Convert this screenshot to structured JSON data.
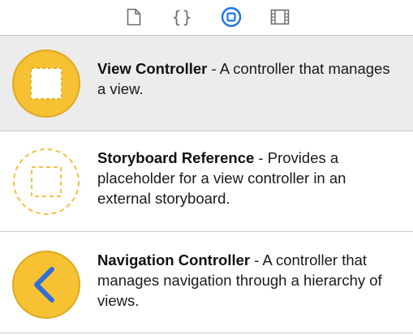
{
  "tabs": [
    {
      "icon": "file-icon"
    },
    {
      "icon": "braces-icon",
      "label": "{}"
    },
    {
      "icon": "object-library-icon"
    },
    {
      "icon": "media-library-icon"
    }
  ],
  "items": [
    {
      "title": "View Controller",
      "separator": " - ",
      "description": "A controller that manages a view.",
      "icon": "view-controller-icon"
    },
    {
      "title": "Storyboard Reference",
      "separator": " - ",
      "description": "Provides a placeholder for a view controller in an external storyboard.",
      "icon": "storyboard-reference-icon"
    },
    {
      "title": "Navigation Controller",
      "separator": " - ",
      "description": "A controller that manages navigation through a hierarchy of views.",
      "icon": "navigation-controller-icon"
    }
  ],
  "colors": {
    "accent_blue": "#1a73e8",
    "icon_yellow": "#f6c233",
    "icon_yellow_dark": "#e0a820",
    "selected_row": "#ececec",
    "divider": "#c9c9c9"
  }
}
